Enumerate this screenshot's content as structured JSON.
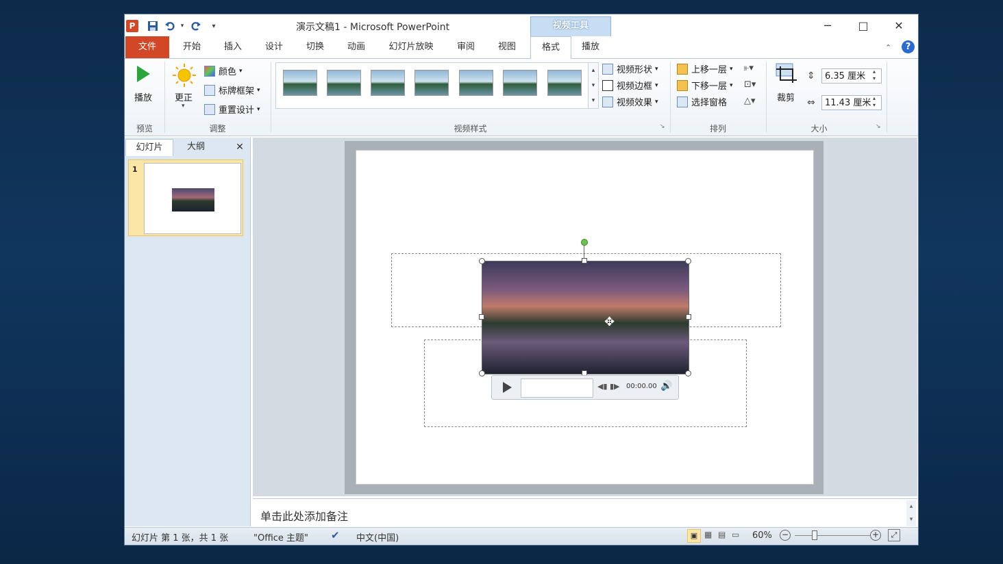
{
  "window": {
    "title": "演示文稿1 - Microsoft PowerPoint",
    "context_tab_header": "视频工具"
  },
  "quick_access": {
    "app_icon": "P",
    "undo_icon": "undo-icon",
    "redo_icon": "redo-icon",
    "save_icon": "save-icon"
  },
  "window_buttons": {
    "minimize": "─",
    "maximize": "□",
    "close": "✕"
  },
  "tabs": [
    "文件",
    "开始",
    "插入",
    "设计",
    "切换",
    "动画",
    "幻灯片放映",
    "审阅",
    "视图",
    "格式",
    "播放"
  ],
  "ribbon": {
    "preview": {
      "play_label": "播放",
      "group_label": "预览"
    },
    "adjust": {
      "correct_label": "更正",
      "color_label": "颜色",
      "poster_frame_label": "标牌框架",
      "reset_design_label": "重置设计",
      "group_label": "调整"
    },
    "video_styles": {
      "shape_label": "视频形状",
      "border_label": "视频边框",
      "effects_label": "视频效果",
      "group_label": "视频样式",
      "thumbnail_count": 7
    },
    "arrange": {
      "bring_forward_label": "上移一层",
      "send_backward_label": "下移一层",
      "selection_pane_label": "选择窗格",
      "group_label": "排列"
    },
    "size": {
      "crop_label": "裁剪",
      "height_value": "6.35 厘米",
      "width_value": "11.43 厘米",
      "group_label": "大小"
    }
  },
  "left_pane": {
    "tab_slides": "幻灯片",
    "tab_outline": "大纲",
    "close": "✕",
    "slide_number": "1"
  },
  "player": {
    "time": "00:00.00"
  },
  "notes": {
    "placeholder": "单击此处添加备注"
  },
  "status": {
    "slide_info": "幻灯片 第 1 张，共 1 张",
    "theme": "\"Office 主题\"",
    "language": "中文(中国)",
    "zoom": "60%"
  }
}
